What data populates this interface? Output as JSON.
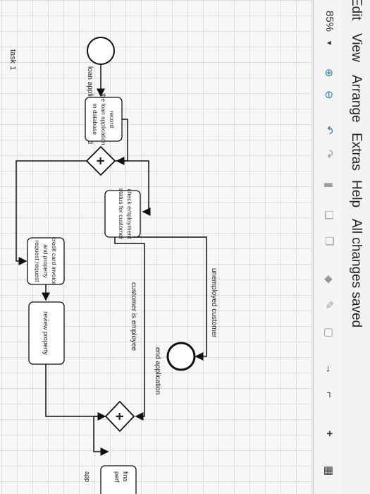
{
  "menu": {
    "edit": "Edit",
    "view": "View",
    "arrange": "Arrange",
    "extras": "Extras",
    "help": "Help",
    "status": "All changes saved"
  },
  "toolbar": {
    "zoom": "85%",
    "icons": [
      "zoom-in-icon",
      "zoom-out-icon",
      "undo-icon",
      "redo-icon",
      "delete-icon",
      "to-front-icon",
      "to-back-icon",
      "fill-color-icon",
      "line-color-icon",
      "shadow-icon",
      "connection-icon",
      "waypoint-icon",
      "insert-icon",
      "table-icon"
    ]
  },
  "diagram": {
    "pool_label": "task 1",
    "start_event_label": "loan application received",
    "task_record": [
      "record",
      "the loan application",
      "in database"
    ],
    "task_check": [
      "check employment",
      "status for customer"
    ],
    "task_credit": [
      "credit card invoice",
      "and property",
      "request request"
    ],
    "task_review": "review property",
    "label_unemployed": "unemployed customer",
    "label_employee": "customer is employee",
    "end_event_label": "end application",
    "cut_label_1": "fina",
    "cut_label_2": "perf",
    "cut_label_3": "app"
  }
}
